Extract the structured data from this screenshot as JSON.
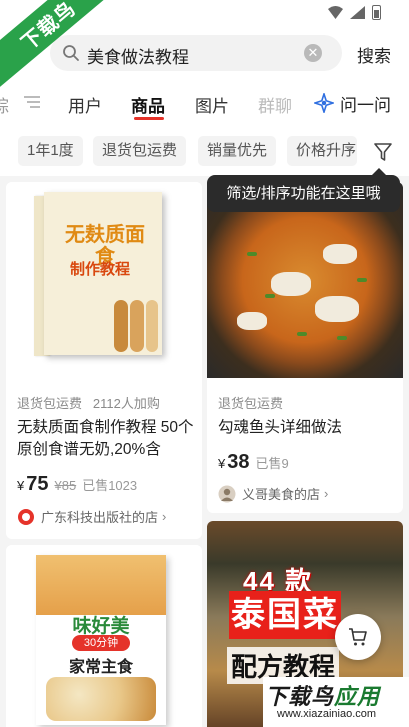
{
  "watermark": {
    "corner_text": "下载鸟",
    "brand_a": "下载鸟",
    "brand_b": "应用",
    "url": "www.xiazainiao.com"
  },
  "search": {
    "query": "美食做法教程",
    "button_label": "搜索"
  },
  "tabs": {
    "partial_left": "综",
    "items": [
      "用户",
      "商品",
      "图片",
      "群聊"
    ],
    "active": "商品",
    "ask_label": "问一问"
  },
  "filters": [
    "1年1度",
    "退货包运费",
    "销量优先",
    "价格升序"
  ],
  "tooltip": "筛选/排序功能在这里哦",
  "products": [
    {
      "cover_title": "无麸质面食",
      "cover_sub": "制作教程",
      "tagline_a": "退货包运费",
      "tagline_b": "2112人加购",
      "title": "无麸质面食制作教程 50个原创食谱无奶,20%含",
      "yen": "¥",
      "price": "75",
      "orig_price": "¥85",
      "sold": "已售1023",
      "shop": "广东科技出版社的店",
      "shop_color": "#e5332a"
    },
    {
      "tagline_a": "退货包运费",
      "title": "勾魂鱼头详细做法",
      "yen": "¥",
      "price": "38",
      "sold": "已售9",
      "shop": "义哥美食的店",
      "shop_color": "#c7b8a4"
    },
    {
      "cover_title": "味好美",
      "cover_badge": "30分钟",
      "cover_sub": "家常主食"
    },
    {
      "cover_num": "44 款",
      "cover_main": "泰国菜",
      "cover_sub": "配方教程"
    }
  ]
}
